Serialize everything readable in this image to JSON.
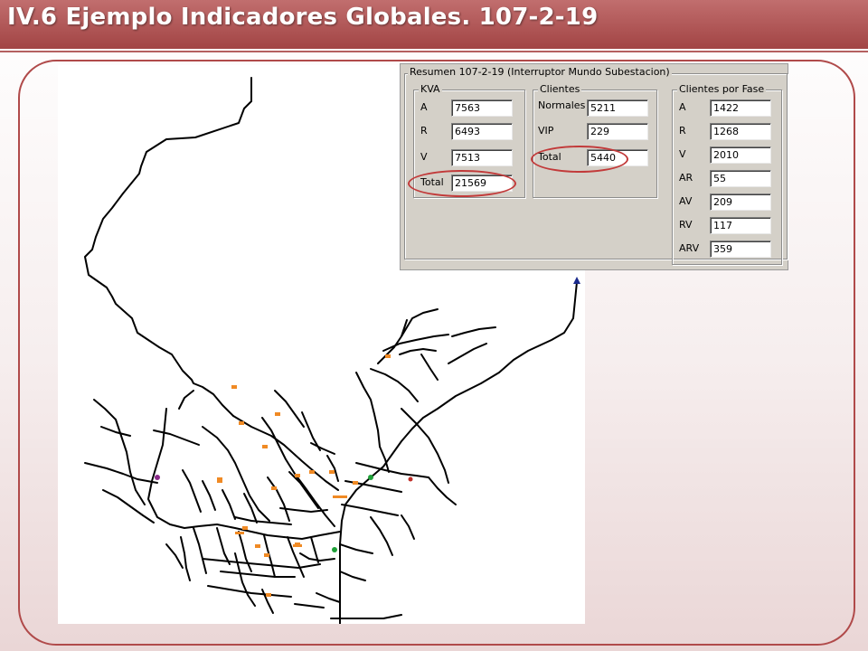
{
  "slide": {
    "title": "IV.6 Ejemplo Indicadores Globales. 107-2-19",
    "accent_color": "#a84848"
  },
  "dialog": {
    "title": "Resumen 107-2-19 (Interruptor Mundo Subestacion)",
    "kva": {
      "label": "KVA",
      "rows": [
        {
          "label": "A",
          "value": "7563"
        },
        {
          "label": "R",
          "value": "6493"
        },
        {
          "label": "V",
          "value": "7513"
        },
        {
          "label": "Total",
          "value": "21569"
        }
      ]
    },
    "clientes": {
      "label": "Clientes",
      "rows": [
        {
          "label": "Normales",
          "value": "5211"
        },
        {
          "label": "VIP",
          "value": "229"
        },
        {
          "label": "Total",
          "value": "5440"
        }
      ]
    },
    "fase": {
      "label": "Clientes por Fase",
      "rows": [
        {
          "label": "A",
          "value": "1422"
        },
        {
          "label": "R",
          "value": "1268"
        },
        {
          "label": "V",
          "value": "2010"
        },
        {
          "label": "AR",
          "value": "55"
        },
        {
          "label": "AV",
          "value": "209"
        },
        {
          "label": "RV",
          "value": "117"
        },
        {
          "label": "ARV",
          "value": "359"
        }
      ]
    }
  },
  "map": {
    "line_color": "#000000",
    "marker_color": "#f08a24",
    "substation_marker": "triangle-icon",
    "substation_color": "#1a2a8c"
  }
}
